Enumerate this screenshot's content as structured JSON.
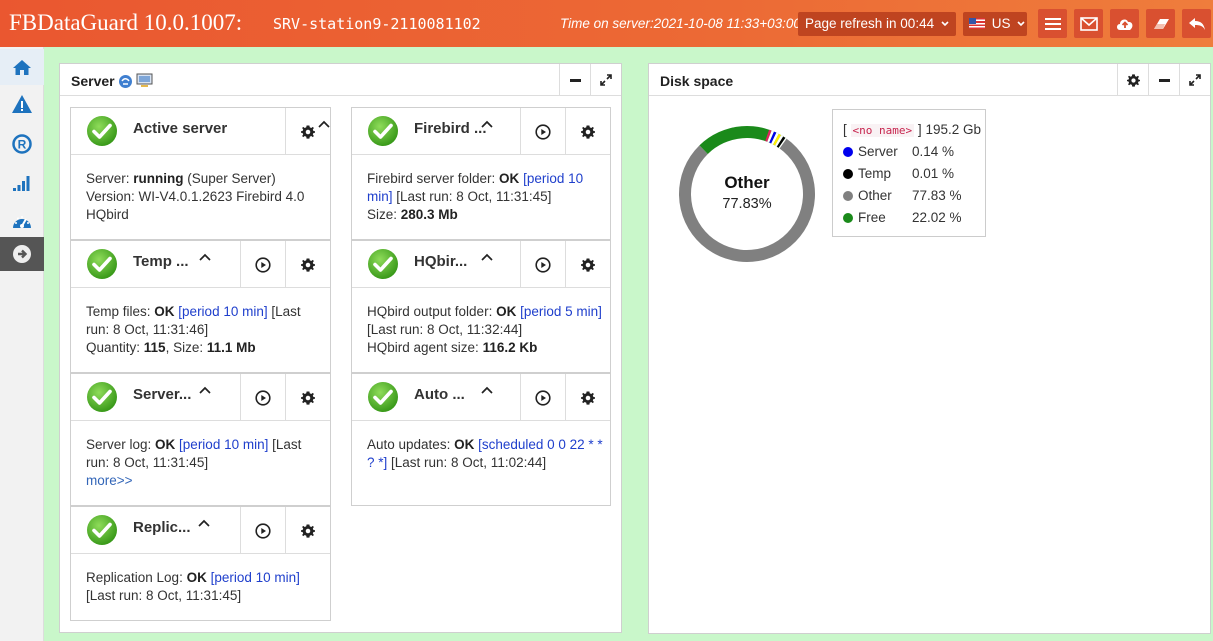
{
  "header": {
    "app_title": "FBDataGuard 10.0.1007:",
    "server_name": "SRV-station9-2110081102",
    "server_time": "Time on server:2021-10-08 11:33+03:00",
    "refresh_label": "Page refresh in 00:44",
    "language": "US",
    "buttons": [
      "menu-icon",
      "mail-icon",
      "cloud-upload-icon",
      "eraser-icon",
      "logout-icon"
    ]
  },
  "sidebar": {
    "items": [
      "home-icon",
      "alert-icon",
      "replication-icon",
      "signal-bars-icon",
      "dashboard-icon",
      "arrow-right-icon"
    ]
  },
  "server_panel": {
    "title": "Server",
    "cards": [
      {
        "title": "Active server",
        "lines": [
          {
            "parts": [
              {
                "t": "Server: "
              },
              {
                "t": "running",
                "b": true
              },
              {
                "t": " (Super Server)"
              }
            ]
          },
          {
            "parts": [
              {
                "t": "Version: WI-V4.0.1.2623 Firebird 4.0"
              }
            ]
          },
          {
            "parts": [
              {
                "t": "HQbird"
              }
            ]
          }
        ]
      },
      {
        "title": "Firebird ...",
        "lines": [
          {
            "parts": [
              {
                "t": "Firebird server folder: "
              },
              {
                "t": "OK",
                "b": true
              },
              {
                "t": " "
              },
              {
                "t": "[period 10",
                "c": "blue"
              }
            ]
          },
          {
            "parts": [
              {
                "t": "min]",
                "c": "blue"
              },
              {
                "t": " [Last run: 8 Oct, 11:31:45]"
              }
            ]
          },
          {
            "parts": [
              {
                "t": "Size: "
              },
              {
                "t": "280.3 Mb",
                "b": true
              }
            ]
          }
        ]
      },
      {
        "title": "Temp ...",
        "lines": [
          {
            "parts": [
              {
                "t": "Temp files: "
              },
              {
                "t": "OK",
                "b": true
              },
              {
                "t": " "
              },
              {
                "t": "[period 10 min]",
                "c": "blue"
              },
              {
                "t": " [Last"
              }
            ]
          },
          {
            "parts": [
              {
                "t": "run: 8 Oct, 11:31:46]"
              }
            ]
          },
          {
            "parts": [
              {
                "t": "Quantity: "
              },
              {
                "t": "115",
                "b": true
              },
              {
                "t": ", Size: "
              },
              {
                "t": "11.1 Mb",
                "b": true
              }
            ]
          }
        ]
      },
      {
        "title": "HQbir...",
        "lines": [
          {
            "parts": [
              {
                "t": "HQbird output folder: "
              },
              {
                "t": "OK",
                "b": true
              },
              {
                "t": " "
              },
              {
                "t": "[period 5 min]",
                "c": "blue"
              }
            ]
          },
          {
            "parts": [
              {
                "t": "[Last run: 8 Oct, 11:32:44]"
              }
            ]
          },
          {
            "parts": [
              {
                "t": "HQbird agent size: "
              },
              {
                "t": "116.2 Kb",
                "b": true
              }
            ]
          }
        ]
      },
      {
        "title": "Server...",
        "lines": [
          {
            "parts": [
              {
                "t": "Server log: "
              },
              {
                "t": "OK",
                "b": true
              },
              {
                "t": " "
              },
              {
                "t": "[period 10 min]",
                "c": "blue"
              },
              {
                "t": " [Last"
              }
            ]
          },
          {
            "parts": [
              {
                "t": "run: 8 Oct, 11:31:45]"
              }
            ]
          },
          {
            "parts": [
              {
                "t": "more>>",
                "c": "more"
              }
            ]
          }
        ]
      },
      {
        "title": "Auto ...",
        "lines": [
          {
            "parts": [
              {
                "t": "Auto updates: "
              },
              {
                "t": "OK",
                "b": true
              },
              {
                "t": " "
              },
              {
                "t": "[scheduled 0 0 22 * *",
                "c": "blue"
              }
            ]
          },
          {
            "parts": [
              {
                "t": "? *]",
                "c": "blue"
              },
              {
                "t": " [Last run: 8 Oct, 11:02:44]"
              }
            ]
          }
        ]
      },
      {
        "title": "Replic...",
        "lines": [
          {
            "parts": [
              {
                "t": "Replication Log: "
              },
              {
                "t": "OK",
                "b": true
              },
              {
                "t": " "
              },
              {
                "t": "[period 10 min]",
                "c": "blue"
              }
            ]
          },
          {
            "parts": [
              {
                "t": "[Last run: 8 Oct, 11:31:45]"
              }
            ]
          }
        ]
      }
    ]
  },
  "disk_panel": {
    "title": "Disk space",
    "center_label": "Other",
    "center_value": "77.83%",
    "legend_header": {
      "open": "[",
      "name": "<no name>",
      "close": "]",
      "total": "195.2 Gb"
    },
    "legend": [
      {
        "name": "Server",
        "value": "0.14 %",
        "color": "#0000ee"
      },
      {
        "name": "Temp",
        "value": "0.01 %",
        "color": "#000000"
      },
      {
        "name": "Other",
        "value": "77.83 %",
        "color": "#808080"
      },
      {
        "name": "Free",
        "value": "22.02 %",
        "color": "#1a8a1a"
      }
    ],
    "donut_segments": [
      {
        "value": 77.83,
        "color": "#808080"
      },
      {
        "value": 22.02,
        "color": "#1a8a1a"
      }
    ],
    "marker_colors": [
      "#e0245e",
      "#ffffff",
      "#0000ee",
      "#ffffff",
      "#ffee00",
      "#ffffff",
      "#000000"
    ]
  }
}
